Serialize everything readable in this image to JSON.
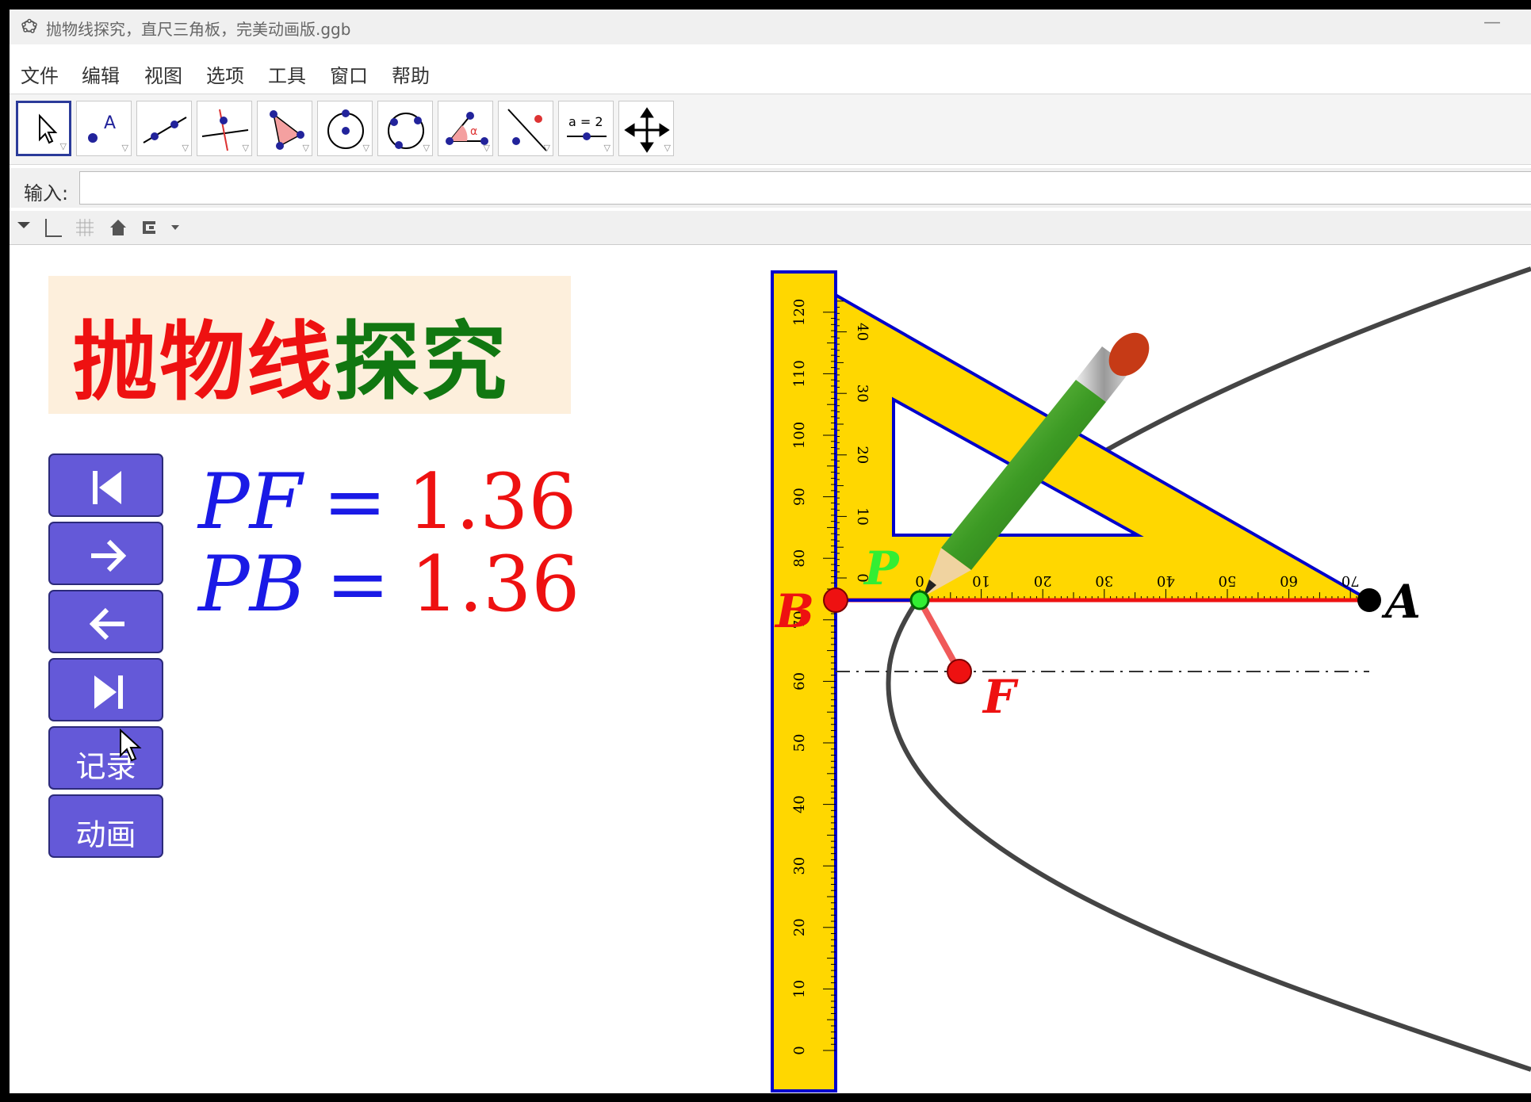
{
  "window": {
    "title": "抛物线探究，直尺三角板，完美动画版.ggb",
    "minimize_symbol": "—"
  },
  "menu": [
    "文件",
    "编辑",
    "视图",
    "选项",
    "工具",
    "窗口",
    "帮助"
  ],
  "toolbar": {
    "tools": [
      {
        "name": "move-tool",
        "active": true
      },
      {
        "name": "point-tool"
      },
      {
        "name": "line-tool"
      },
      {
        "name": "perpendicular-line-tool"
      },
      {
        "name": "polygon-tool"
      },
      {
        "name": "circle-tool"
      },
      {
        "name": "conic-tool"
      },
      {
        "name": "angle-tool"
      },
      {
        "name": "reflect-tool"
      },
      {
        "name": "slider-tool",
        "label": "a = 2"
      },
      {
        "name": "move-graphics-view-tool"
      }
    ]
  },
  "input_bar": {
    "label": "输入:",
    "value": ""
  },
  "title_banner": {
    "part_red": "抛物线",
    "part_green": "探究",
    "bg_color": "#fdefdc"
  },
  "buttons": {
    "first_icon": "skip-to-start-icon",
    "next_icon": "arrow-right-icon",
    "prev_icon": "arrow-left-icon",
    "last_icon": "skip-to-end-icon",
    "record_label": "记录",
    "animate_label": "动画",
    "color": "#6459d8"
  },
  "equations": [
    {
      "lhs": "PF",
      "op": "=",
      "value": "1.36"
    },
    {
      "lhs": "PB",
      "op": "=",
      "value": "1.36"
    }
  ],
  "figure": {
    "points": {
      "A": "A",
      "B": "B",
      "P": "P",
      "F": "F"
    },
    "ruler_ticks": [
      "0",
      "10",
      "20",
      "30",
      "40",
      "50",
      "60",
      "70",
      "80",
      "90",
      "100",
      "110",
      "120"
    ],
    "triangle_vertical_ticks": [
      "0",
      "10",
      "20",
      "30",
      "40"
    ],
    "triangle_horizontal_ticks": [
      "0",
      "10",
      "20",
      "30",
      "40",
      "50",
      "60",
      "70"
    ],
    "colors": {
      "ruler": "#ffd700",
      "outline": "#0000cc",
      "parabola": "#444444",
      "segment": "#ee1111"
    }
  }
}
